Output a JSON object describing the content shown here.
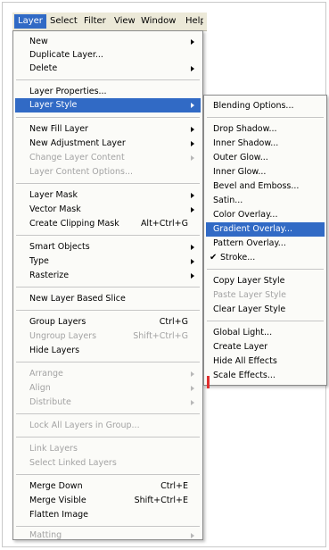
{
  "menubar": {
    "items": [
      "Layer",
      "Select",
      "Filter",
      "View",
      "Window",
      "Help"
    ]
  },
  "layer_menu": {
    "items": [
      {
        "label": "New",
        "submenu": true
      },
      {
        "label": "Duplicate Layer..."
      },
      {
        "label": "Delete",
        "submenu": true
      },
      {
        "label": "Layer Properties..."
      },
      {
        "label": "Layer Style",
        "submenu": true,
        "highlighted": true
      },
      {
        "label": "New Fill Layer",
        "submenu": true
      },
      {
        "label": "New Adjustment Layer",
        "submenu": true
      },
      {
        "label": "Change Layer Content",
        "submenu": true,
        "disabled": true
      },
      {
        "label": "Layer Content Options...",
        "disabled": true
      },
      {
        "label": "Layer Mask",
        "submenu": true
      },
      {
        "label": "Vector Mask",
        "submenu": true
      },
      {
        "label": "Create Clipping Mask",
        "shortcut": "Alt+Ctrl+G"
      },
      {
        "label": "Smart Objects",
        "submenu": true
      },
      {
        "label": "Type",
        "submenu": true
      },
      {
        "label": "Rasterize",
        "submenu": true
      },
      {
        "label": "New Layer Based Slice"
      },
      {
        "label": "Group Layers",
        "shortcut": "Ctrl+G"
      },
      {
        "label": "Ungroup Layers",
        "shortcut": "Shift+Ctrl+G",
        "disabled": true
      },
      {
        "label": "Hide Layers"
      },
      {
        "label": "Arrange",
        "submenu": true,
        "disabled": true
      },
      {
        "label": "Align",
        "submenu": true,
        "disabled": true
      },
      {
        "label": "Distribute",
        "submenu": true,
        "disabled": true
      },
      {
        "label": "Lock All Layers in Group...",
        "disabled": true
      },
      {
        "label": "Link Layers",
        "disabled": true
      },
      {
        "label": "Select Linked Layers",
        "disabled": true
      },
      {
        "label": "Merge Down",
        "shortcut": "Ctrl+E"
      },
      {
        "label": "Merge Visible",
        "shortcut": "Shift+Ctrl+E"
      },
      {
        "label": "Flatten Image"
      },
      {
        "label": "Matting",
        "submenu": true,
        "disabled": true
      }
    ]
  },
  "layer_style_submenu": {
    "items": [
      {
        "label": "Blending Options..."
      },
      {
        "label": "Drop Shadow..."
      },
      {
        "label": "Inner Shadow..."
      },
      {
        "label": "Outer Glow..."
      },
      {
        "label": "Inner Glow..."
      },
      {
        "label": "Bevel and Emboss..."
      },
      {
        "label": "Satin..."
      },
      {
        "label": "Color Overlay..."
      },
      {
        "label": "Gradient Overlay...",
        "highlighted": true
      },
      {
        "label": "Pattern Overlay..."
      },
      {
        "label": "Stroke...",
        "checked": true
      },
      {
        "label": "Copy Layer Style"
      },
      {
        "label": "Paste Layer Style",
        "disabled": true
      },
      {
        "label": "Clear Layer Style"
      },
      {
        "label": "Global Light..."
      },
      {
        "label": "Create Layer"
      },
      {
        "label": "Hide All Effects"
      },
      {
        "label": "Scale Effects..."
      }
    ]
  },
  "colors": {
    "highlight": "#316ac5",
    "disabled_text": "#a3a3a3",
    "menubar_bg": "#ece9d8"
  },
  "icons": {
    "submenu_arrow": "triangle-right",
    "check_mark": "✔"
  }
}
